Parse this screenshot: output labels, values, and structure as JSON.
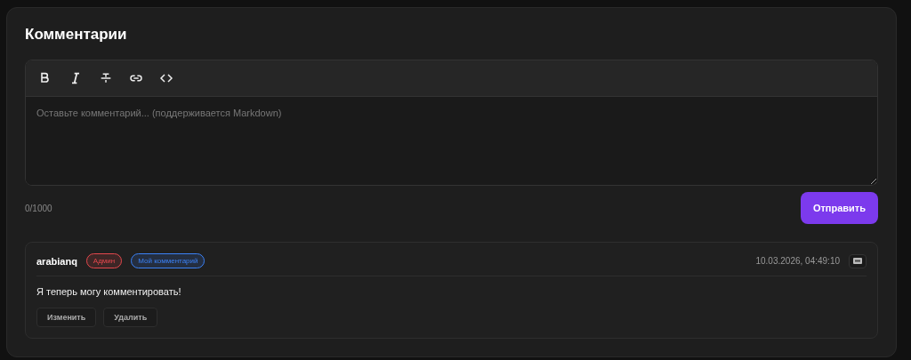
{
  "title": "Комментарии",
  "editor": {
    "toolbar": [
      {
        "kind": "bold"
      },
      {
        "kind": "italic"
      },
      {
        "kind": "strike"
      },
      {
        "kind": "link"
      },
      {
        "kind": "code"
      }
    ],
    "placeholder": "Оставьте комментарий... (поддерживается Markdown)"
  },
  "counter": "0/1000",
  "submit": "Отправить",
  "comments": [
    {
      "author": "arabianq",
      "badges": [
        {
          "label": "Админ",
          "color": "#e5484d"
        },
        {
          "label": "Мой комментарий",
          "color": "#3b82f6"
        }
      ],
      "time": "10.03.2026, 04:49:10",
      "text": "Я теперь могу комментировать!",
      "actions": [
        "Изменить",
        "Удалить"
      ]
    }
  ]
}
